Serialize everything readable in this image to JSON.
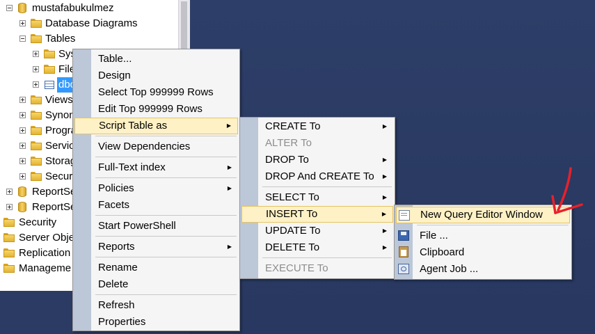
{
  "tree": {
    "items": [
      {
        "label": "mustafabukulmez",
        "icon": "database-icon",
        "expander": "minus"
      },
      {
        "label": "Database Diagrams",
        "icon": "folder-icon",
        "expander": "plus"
      },
      {
        "label": "Tables",
        "icon": "folder-icon",
        "expander": "minus"
      },
      {
        "label": "Sys",
        "icon": "folder-icon",
        "expander": "plus"
      },
      {
        "label": "File",
        "icon": "folder-icon",
        "expander": "plus"
      },
      {
        "label": "dbo",
        "icon": "table-icon",
        "expander": "plus"
      },
      {
        "label": "Views",
        "icon": "folder-icon",
        "expander": "plus"
      },
      {
        "label": "Synon",
        "icon": "folder-icon",
        "expander": "plus"
      },
      {
        "label": "Progra",
        "icon": "folder-icon",
        "expander": "plus"
      },
      {
        "label": "Servic",
        "icon": "folder-icon",
        "expander": "plus"
      },
      {
        "label": "Storag",
        "icon": "folder-icon",
        "expander": "plus"
      },
      {
        "label": "Securi",
        "icon": "folder-icon",
        "expander": "plus"
      },
      {
        "label": "ReportSe",
        "icon": "database-icon",
        "expander": "plus"
      },
      {
        "label": "ReportSe",
        "icon": "database-icon",
        "expander": "plus"
      },
      {
        "label": "Security",
        "icon": "folder-icon",
        "expander": "plus"
      },
      {
        "label": "Server Obje",
        "icon": "folder-icon",
        "expander": "plus"
      },
      {
        "label": "Replication",
        "icon": "folder-icon",
        "expander": "plus"
      },
      {
        "label": "Manageme",
        "icon": "folder-icon",
        "expander": "plus"
      }
    ]
  },
  "context_menu": {
    "items": [
      {
        "label": "Table..."
      },
      {
        "label": "Design"
      },
      {
        "label": "Select Top 999999 Rows"
      },
      {
        "label": "Edit Top 999999 Rows"
      },
      {
        "label": "Script Table as",
        "submenu": true,
        "highlighted": true
      },
      {
        "label": "View Dependencies"
      },
      {
        "label": "Full-Text index",
        "submenu": true
      },
      {
        "label": "Policies",
        "submenu": true
      },
      {
        "label": "Facets"
      },
      {
        "label": "Start PowerShell"
      },
      {
        "label": "Reports",
        "submenu": true
      },
      {
        "label": "Rename"
      },
      {
        "label": "Delete"
      },
      {
        "label": "Refresh"
      },
      {
        "label": "Properties"
      }
    ]
  },
  "script_menu": {
    "items": [
      {
        "label": "CREATE To",
        "submenu": true
      },
      {
        "label": "ALTER To",
        "disabled": true
      },
      {
        "label": "DROP To",
        "submenu": true
      },
      {
        "label": "DROP And CREATE To",
        "submenu": true
      },
      {
        "label": "SELECT To",
        "submenu": true
      },
      {
        "label": "INSERT To",
        "submenu": true,
        "highlighted": true
      },
      {
        "label": "UPDATE To",
        "submenu": true
      },
      {
        "label": "DELETE To",
        "submenu": true
      },
      {
        "label": "EXECUTE To",
        "disabled": true
      }
    ]
  },
  "insert_menu": {
    "items": [
      {
        "label": "New Query Editor Window",
        "icon": "query-window-icon",
        "highlighted": true
      },
      {
        "label": "File ...",
        "icon": "save-file-icon"
      },
      {
        "label": "Clipboard",
        "icon": "clipboard-icon"
      },
      {
        "label": "Agent Job ...",
        "icon": "agent-job-icon"
      }
    ]
  },
  "annotation": {
    "arrow_color": "#e8202a"
  }
}
